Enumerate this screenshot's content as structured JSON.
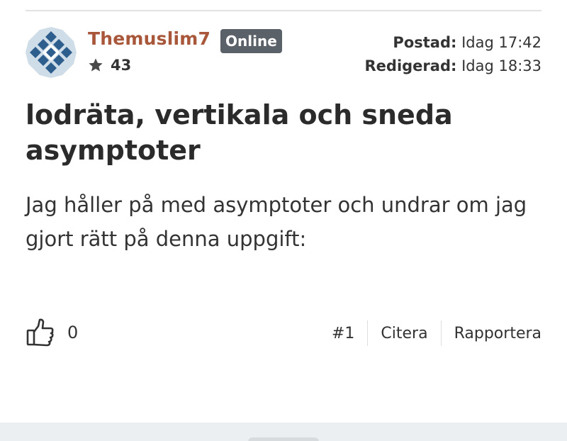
{
  "post": {
    "author": "Themuslim7",
    "status_badge": "Online",
    "reputation": "43",
    "posted_label": "Postad:",
    "posted_value": "Idag 17:42",
    "edited_label": "Redigerad:",
    "edited_value": "Idag 18:33",
    "title": "lodräta, vertikala och sneda asymptoter",
    "body": "Jag håller på med asymptoter och undrar om jag gjort rätt på denna uppgift:"
  },
  "footer": {
    "like_count": "0",
    "post_number": "#1",
    "quote_label": "Citera",
    "report_label": "Rapportera"
  },
  "colors": {
    "username": "#a9573a",
    "badge_bg": "#5b6168",
    "avatar_blue": "#2d5e8e",
    "text": "#333333"
  },
  "icons": {
    "avatar": "geometric-quilt-avatar",
    "reputation": "star-icon",
    "like": "thumbs-up-icon"
  }
}
